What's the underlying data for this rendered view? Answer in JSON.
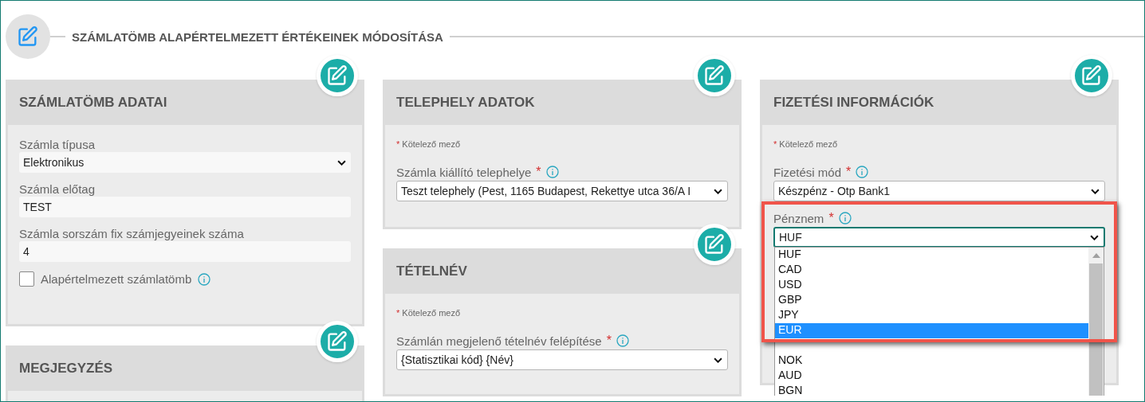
{
  "page": {
    "title": "SZÁMLATÖMB ALAPÉRTELMEZETT ÉRTÉKEINEK MÓDOSÍTÁSA"
  },
  "columns": [
    {
      "cards": [
        {
          "title": "SZÁMLATÖMB ADATAI",
          "fields": [
            {
              "kind": "select",
              "label": "Számla típusa",
              "value": "Elektronikus",
              "info": false
            },
            {
              "kind": "text",
              "label": "Számla előtag",
              "value": "TEST",
              "info": false
            },
            {
              "kind": "text",
              "label": "Számla sorszám fix számjegyeinek száma",
              "value": "4",
              "info": false
            },
            {
              "kind": "checkbox",
              "label": "Alapértelmezett számlatömb",
              "checked": false,
              "info": true
            }
          ]
        },
        {
          "title": "MEGJEGYZÉS"
        }
      ]
    },
    {
      "cards": [
        {
          "title": "TELEPHELY ADATOK",
          "note": {
            "mark": "*",
            "text": "Kötelező mező"
          },
          "fields": [
            {
              "kind": "select",
              "label": "Számla kiállító telephelye",
              "required_mark": "*",
              "info": true,
              "value": "Teszt telephely (Pest, 1165 Budapest, Rekettye utca 36/A I"
            }
          ]
        },
        {
          "title": "TÉTELNÉV",
          "note": {
            "mark": "*",
            "text": "Kötelező mező"
          },
          "fields": [
            {
              "kind": "select",
              "label": "Számlán megjelenő tételnév felépítése",
              "required_mark": "*",
              "info": true,
              "value": "{Statisztikai kód} {Név}"
            }
          ]
        }
      ]
    },
    {
      "cards": [
        {
          "title": "FIZETÉSI INFORMÁCIÓK",
          "note": {
            "mark": "*",
            "text": "Kötelező mező"
          },
          "fields": [
            {
              "kind": "select",
              "label": "Fizetési mód",
              "required_mark": "*",
              "info": true,
              "value": "Készpénz - Otp Bank1"
            },
            {
              "kind": "select",
              "label": "Pénznem",
              "required_mark": "*",
              "info": true,
              "value": "HUF",
              "focused": true,
              "highlighted": true,
              "dropdown": {
                "options": [
                  {
                    "label": "HUF",
                    "selected": false
                  },
                  {
                    "label": "CAD",
                    "selected": false
                  },
                  {
                    "label": "USD",
                    "selected": false
                  },
                  {
                    "label": "GBP",
                    "selected": false
                  },
                  {
                    "label": "JPY",
                    "selected": false
                  },
                  {
                    "label": "EUR",
                    "selected": true
                  },
                  {
                    "selected": false
                  },
                  {
                    "label": "NOK",
                    "selected": false
                  },
                  {
                    "label": "AUD",
                    "selected": false
                  },
                  {
                    "label": "BGN",
                    "selected": false
                  }
                ]
              }
            }
          ]
        }
      ]
    }
  ]
}
